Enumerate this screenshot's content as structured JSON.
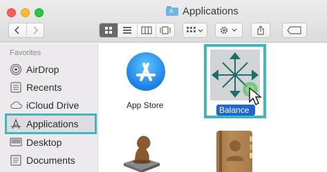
{
  "window": {
    "title": "Applications",
    "title_icon": "folder-icon"
  },
  "toolbar": {
    "back_icon": "chevron-left-icon",
    "forward_icon": "chevron-right-icon",
    "view_modes": [
      "icon-view-icon",
      "list-view-icon",
      "column-view-icon",
      "gallery-view-icon"
    ],
    "arrange_icon": "arrange-grid-icon",
    "action_icon": "gear-icon",
    "share_icon": "share-icon",
    "tag_icon": "tag-icon"
  },
  "sidebar": {
    "heading": "Favorites",
    "items": [
      {
        "label": "AirDrop",
        "icon": "airdrop-icon"
      },
      {
        "label": "Recents",
        "icon": "recents-icon"
      },
      {
        "label": "iCloud Drive",
        "icon": "cloud-icon"
      },
      {
        "label": "Applications",
        "icon": "applications-icon",
        "selected": true
      },
      {
        "label": "Desktop",
        "icon": "desktop-icon"
      },
      {
        "label": "Documents",
        "icon": "documents-icon"
      }
    ]
  },
  "content": {
    "apps": [
      {
        "label": "App Store",
        "icon": "app-store-icon"
      },
      {
        "label": "Balance",
        "icon": "balance-app-icon",
        "selected": true
      },
      {
        "label": "",
        "icon": "chess-icon"
      },
      {
        "label": "",
        "icon": "contacts-book-icon"
      }
    ]
  },
  "colors": {
    "highlight": "#3fb5bd",
    "selection_blue": "#1c66d6"
  }
}
